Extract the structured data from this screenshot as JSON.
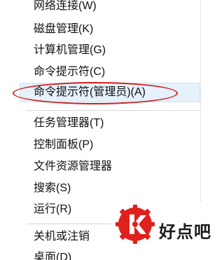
{
  "menu": {
    "items": [
      {
        "label": "网络连接(W)"
      },
      {
        "label": "磁盘管理(K)"
      },
      {
        "label": "计算机管理(G)"
      },
      {
        "label": "命令提示符(C)"
      },
      {
        "label": "命令提示符(管理员)(A)"
      },
      {
        "label": "任务管理器(T)"
      },
      {
        "label": "控制面板(P)"
      },
      {
        "label": "文件资源管理器"
      },
      {
        "label": "搜索(S)"
      },
      {
        "label": "运行(R)"
      },
      {
        "label": "关机或注销"
      },
      {
        "label": "桌面(D)"
      }
    ],
    "selected_index": 4
  },
  "annotation": {
    "color": "#d21f1f"
  },
  "watermark": {
    "brand": "好点吧",
    "badge_color": "#e0201c",
    "icon": "stylized-k-gear-icon"
  }
}
